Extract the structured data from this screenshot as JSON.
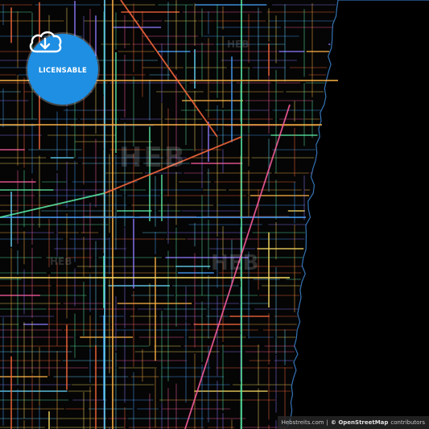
{
  "badge": {
    "label": "LICENSABLE",
    "icon": "cloud-download-icon",
    "color": "#1e8fe3"
  },
  "attribution": {
    "brand": "Hebstreits.com",
    "sep": "|",
    "osm": "© OpenStreetMap",
    "suffix": "contributors"
  },
  "watermark": {
    "text": "HEB"
  },
  "colors": {
    "water": "#000000",
    "land": "#050505",
    "roads": [
      "#ff6b3d",
      "#ffb347",
      "#6bdcff",
      "#ff5fa2",
      "#8f7bff",
      "#5cf0a8",
      "#ffe066",
      "#4aa3ff"
    ]
  }
}
